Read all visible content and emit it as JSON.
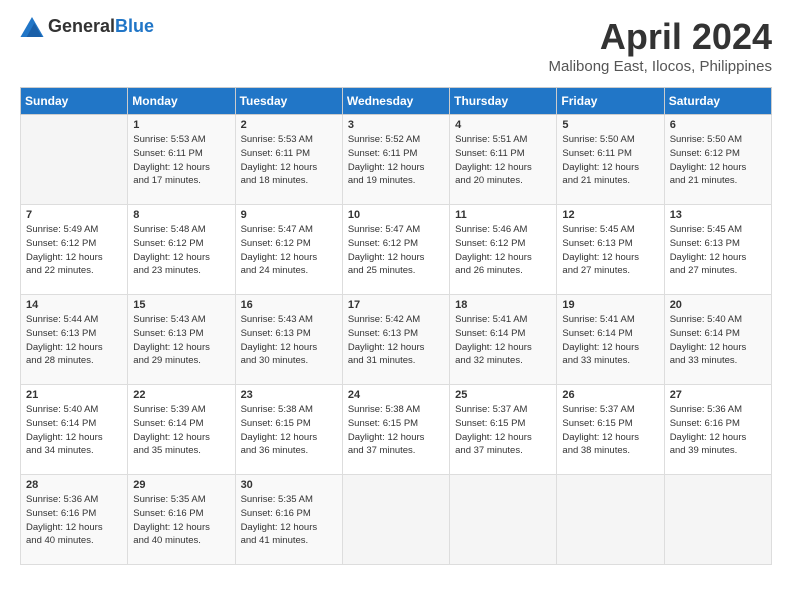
{
  "header": {
    "logo_general": "General",
    "logo_blue": "Blue",
    "month": "April 2024",
    "location": "Malibong East, Ilocos, Philippines"
  },
  "weekdays": [
    "Sunday",
    "Monday",
    "Tuesday",
    "Wednesday",
    "Thursday",
    "Friday",
    "Saturday"
  ],
  "weeks": [
    [
      {
        "day": "",
        "info": ""
      },
      {
        "day": "1",
        "info": "Sunrise: 5:53 AM\nSunset: 6:11 PM\nDaylight: 12 hours\nand 17 minutes."
      },
      {
        "day": "2",
        "info": "Sunrise: 5:53 AM\nSunset: 6:11 PM\nDaylight: 12 hours\nand 18 minutes."
      },
      {
        "day": "3",
        "info": "Sunrise: 5:52 AM\nSunset: 6:11 PM\nDaylight: 12 hours\nand 19 minutes."
      },
      {
        "day": "4",
        "info": "Sunrise: 5:51 AM\nSunset: 6:11 PM\nDaylight: 12 hours\nand 20 minutes."
      },
      {
        "day": "5",
        "info": "Sunrise: 5:50 AM\nSunset: 6:11 PM\nDaylight: 12 hours\nand 21 minutes."
      },
      {
        "day": "6",
        "info": "Sunrise: 5:50 AM\nSunset: 6:12 PM\nDaylight: 12 hours\nand 21 minutes."
      }
    ],
    [
      {
        "day": "7",
        "info": "Sunrise: 5:49 AM\nSunset: 6:12 PM\nDaylight: 12 hours\nand 22 minutes."
      },
      {
        "day": "8",
        "info": "Sunrise: 5:48 AM\nSunset: 6:12 PM\nDaylight: 12 hours\nand 23 minutes."
      },
      {
        "day": "9",
        "info": "Sunrise: 5:47 AM\nSunset: 6:12 PM\nDaylight: 12 hours\nand 24 minutes."
      },
      {
        "day": "10",
        "info": "Sunrise: 5:47 AM\nSunset: 6:12 PM\nDaylight: 12 hours\nand 25 minutes."
      },
      {
        "day": "11",
        "info": "Sunrise: 5:46 AM\nSunset: 6:12 PM\nDaylight: 12 hours\nand 26 minutes."
      },
      {
        "day": "12",
        "info": "Sunrise: 5:45 AM\nSunset: 6:13 PM\nDaylight: 12 hours\nand 27 minutes."
      },
      {
        "day": "13",
        "info": "Sunrise: 5:45 AM\nSunset: 6:13 PM\nDaylight: 12 hours\nand 27 minutes."
      }
    ],
    [
      {
        "day": "14",
        "info": "Sunrise: 5:44 AM\nSunset: 6:13 PM\nDaylight: 12 hours\nand 28 minutes."
      },
      {
        "day": "15",
        "info": "Sunrise: 5:43 AM\nSunset: 6:13 PM\nDaylight: 12 hours\nand 29 minutes."
      },
      {
        "day": "16",
        "info": "Sunrise: 5:43 AM\nSunset: 6:13 PM\nDaylight: 12 hours\nand 30 minutes."
      },
      {
        "day": "17",
        "info": "Sunrise: 5:42 AM\nSunset: 6:13 PM\nDaylight: 12 hours\nand 31 minutes."
      },
      {
        "day": "18",
        "info": "Sunrise: 5:41 AM\nSunset: 6:14 PM\nDaylight: 12 hours\nand 32 minutes."
      },
      {
        "day": "19",
        "info": "Sunrise: 5:41 AM\nSunset: 6:14 PM\nDaylight: 12 hours\nand 33 minutes."
      },
      {
        "day": "20",
        "info": "Sunrise: 5:40 AM\nSunset: 6:14 PM\nDaylight: 12 hours\nand 33 minutes."
      }
    ],
    [
      {
        "day": "21",
        "info": "Sunrise: 5:40 AM\nSunset: 6:14 PM\nDaylight: 12 hours\nand 34 minutes."
      },
      {
        "day": "22",
        "info": "Sunrise: 5:39 AM\nSunset: 6:14 PM\nDaylight: 12 hours\nand 35 minutes."
      },
      {
        "day": "23",
        "info": "Sunrise: 5:38 AM\nSunset: 6:15 PM\nDaylight: 12 hours\nand 36 minutes."
      },
      {
        "day": "24",
        "info": "Sunrise: 5:38 AM\nSunset: 6:15 PM\nDaylight: 12 hours\nand 37 minutes."
      },
      {
        "day": "25",
        "info": "Sunrise: 5:37 AM\nSunset: 6:15 PM\nDaylight: 12 hours\nand 37 minutes."
      },
      {
        "day": "26",
        "info": "Sunrise: 5:37 AM\nSunset: 6:15 PM\nDaylight: 12 hours\nand 38 minutes."
      },
      {
        "day": "27",
        "info": "Sunrise: 5:36 AM\nSunset: 6:16 PM\nDaylight: 12 hours\nand 39 minutes."
      }
    ],
    [
      {
        "day": "28",
        "info": "Sunrise: 5:36 AM\nSunset: 6:16 PM\nDaylight: 12 hours\nand 40 minutes."
      },
      {
        "day": "29",
        "info": "Sunrise: 5:35 AM\nSunset: 6:16 PM\nDaylight: 12 hours\nand 40 minutes."
      },
      {
        "day": "30",
        "info": "Sunrise: 5:35 AM\nSunset: 6:16 PM\nDaylight: 12 hours\nand 41 minutes."
      },
      {
        "day": "",
        "info": ""
      },
      {
        "day": "",
        "info": ""
      },
      {
        "day": "",
        "info": ""
      },
      {
        "day": "",
        "info": ""
      }
    ]
  ]
}
